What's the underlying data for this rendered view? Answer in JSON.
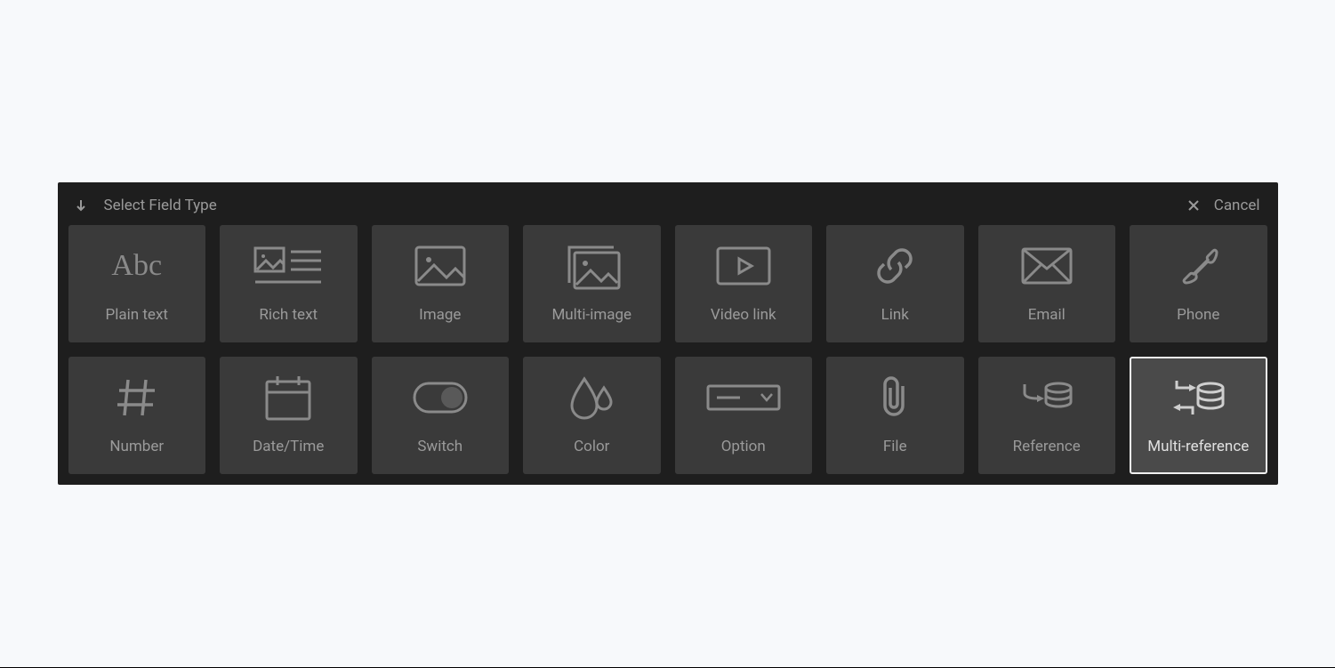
{
  "header": {
    "title": "Select Field Type",
    "cancel": "Cancel"
  },
  "tiles": [
    {
      "label": "Plain text"
    },
    {
      "label": "Rich text"
    },
    {
      "label": "Image"
    },
    {
      "label": "Multi-image"
    },
    {
      "label": "Video link"
    },
    {
      "label": "Link"
    },
    {
      "label": "Email"
    },
    {
      "label": "Phone"
    },
    {
      "label": "Number"
    },
    {
      "label": "Date/Time"
    },
    {
      "label": "Switch"
    },
    {
      "label": "Color"
    },
    {
      "label": "Option"
    },
    {
      "label": "File"
    },
    {
      "label": "Reference"
    },
    {
      "label": "Multi-reference"
    }
  ],
  "selected_index": 15
}
